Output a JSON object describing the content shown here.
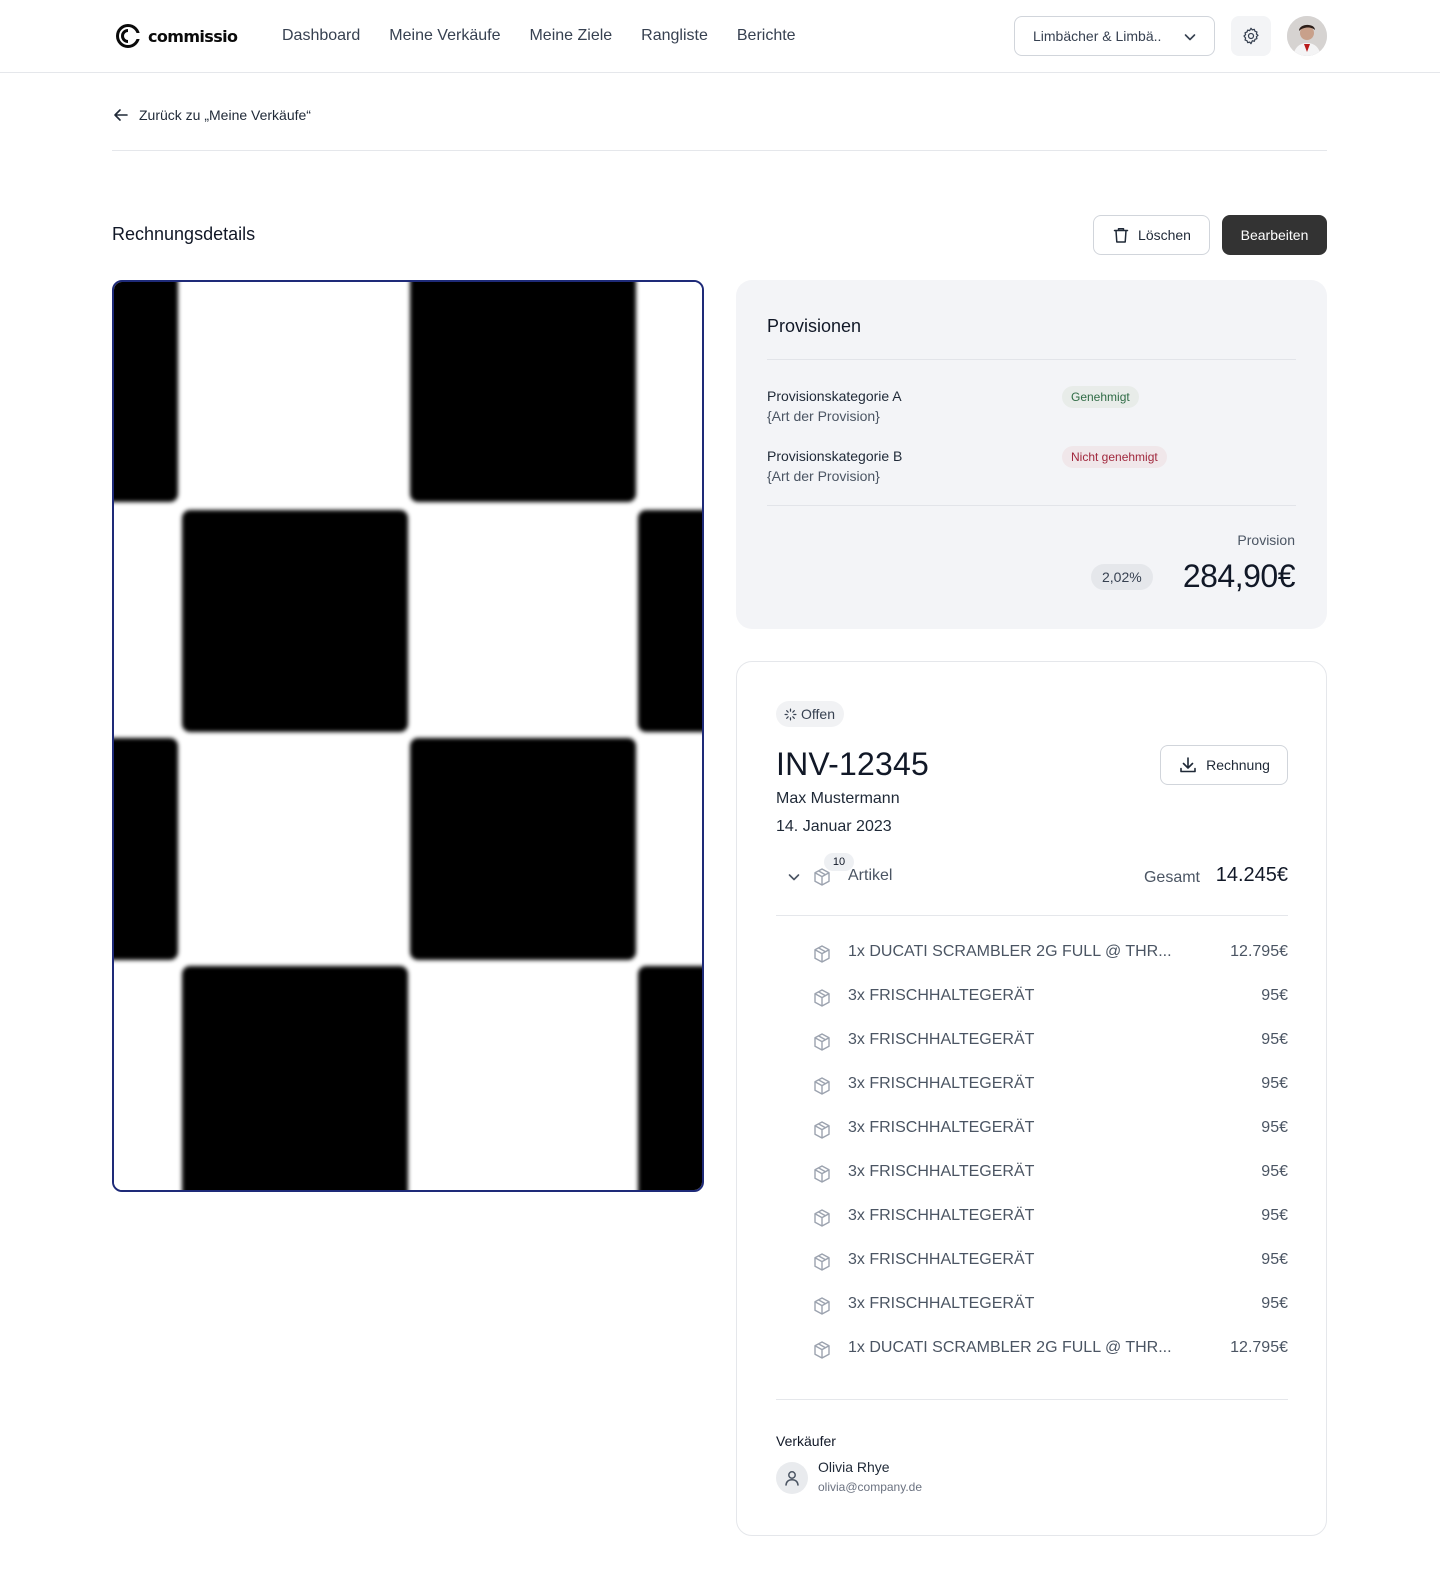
{
  "app": {
    "logo_text": "commissio",
    "nav": [
      "Dashboard",
      "Meine Verkäufe",
      "Meine Ziele",
      "Rangliste",
      "Berichte"
    ],
    "org_select": "Limbächer & Limbä..",
    "icons": {
      "settings": "gear-icon",
      "dropdown": "chevron-down-icon"
    }
  },
  "breadcrumb": {
    "back_label": "Zurück zu „Meine Verkäufe“"
  },
  "page": {
    "title": "Rechnungsdetails",
    "delete_label": "Löschen",
    "edit_label": "Bearbeiten"
  },
  "commissions": {
    "title": "Provisionen",
    "rows": [
      {
        "name": "Provisionskategorie A",
        "type": "{Art der Provision}",
        "status": "Genehmigt",
        "status_color": "#2f6b45"
      },
      {
        "name": "Provisionskategorie B",
        "type": "{Art der Provision}",
        "status": "Nicht genehmigt",
        "status_color": "#a1283d"
      }
    ],
    "label": "Provision",
    "rate": "2,02%",
    "amount": "284,90€"
  },
  "invoice": {
    "status": "Offen",
    "number": "INV-12345",
    "download_label": "Rechnung",
    "customer": "Max Mustermann",
    "date": "14. Januar 2023",
    "items_count": "10",
    "items_label": "Artikel",
    "total_label": "Gesamt",
    "total": "14.245€",
    "items": [
      {
        "desc": "1x DUCATI SCRAMBLER 2G FULL @ THR...",
        "price": "12.795€"
      },
      {
        "desc": "3x FRISCHHALTEGERÄT",
        "price": "95€"
      },
      {
        "desc": "3x FRISCHHALTEGERÄT",
        "price": "95€"
      },
      {
        "desc": "3x FRISCHHALTEGERÄT",
        "price": "95€"
      },
      {
        "desc": "3x FRISCHHALTEGERÄT",
        "price": "95€"
      },
      {
        "desc": "3x FRISCHHALTEGERÄT",
        "price": "95€"
      },
      {
        "desc": "3x FRISCHHALTEGERÄT",
        "price": "95€"
      },
      {
        "desc": "3x FRISCHHALTEGERÄT",
        "price": "95€"
      },
      {
        "desc": "3x FRISCHHALTEGERÄT",
        "price": "95€"
      },
      {
        "desc": "1x DUCATI SCRAMBLER 2G FULL @ THR...",
        "price": "12.795€"
      }
    ],
    "seller_label": "Verkäufer",
    "seller_name": "Olivia Rhye",
    "seller_email": "olivia@company.de"
  },
  "colors": {
    "primary_button": "#333333",
    "preview_border": "#1e2a78",
    "card_bg": "#f3f4f7"
  }
}
